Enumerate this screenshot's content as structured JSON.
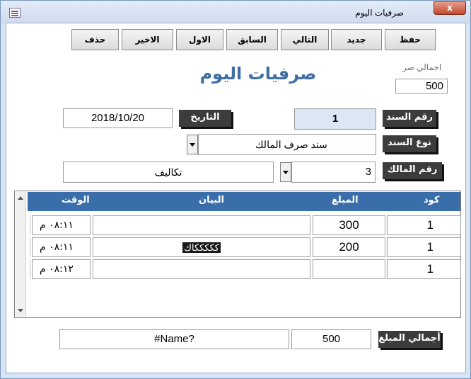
{
  "window": {
    "title": "صرفيات اليوم",
    "close_label": "x",
    "icon": "form-icon"
  },
  "toolbar": {
    "save_label": "حفظ",
    "new_label": "جديد",
    "next_label": "التالي",
    "prev_label": "السابق",
    "first_label": "الاول",
    "last_label": "الاخير",
    "delete_label": "حذف"
  },
  "summary": {
    "label": "اجمالي صر",
    "value": "500"
  },
  "form_title": "صرفيات اليوم",
  "voucher": {
    "label": "رقم السند",
    "value": "1"
  },
  "date": {
    "label": "التاريخ",
    "value": "2018/10/20"
  },
  "voucher_type": {
    "label": "نوع السند",
    "value": "سند صرف المالك"
  },
  "owner": {
    "label": "رقم المالك",
    "value": "3",
    "name": "تكاليف"
  },
  "grid": {
    "headers": {
      "code": "كود",
      "amount": "المبلغ",
      "description": "البيان",
      "time": "الوقت"
    },
    "rows": [
      {
        "code": "1",
        "amount": "300",
        "description": "",
        "time": "٠٨:١١ م"
      },
      {
        "code": "1",
        "amount": "200",
        "description": "كككككاك",
        "time": "٠٨:١١ م"
      },
      {
        "code": "1",
        "amount": "",
        "description": "",
        "time": "٠٨:١٢ م"
      }
    ]
  },
  "footer": {
    "total_label": "أجمالي المبلغ",
    "total_value": "500",
    "name_value": "#Name?"
  }
}
